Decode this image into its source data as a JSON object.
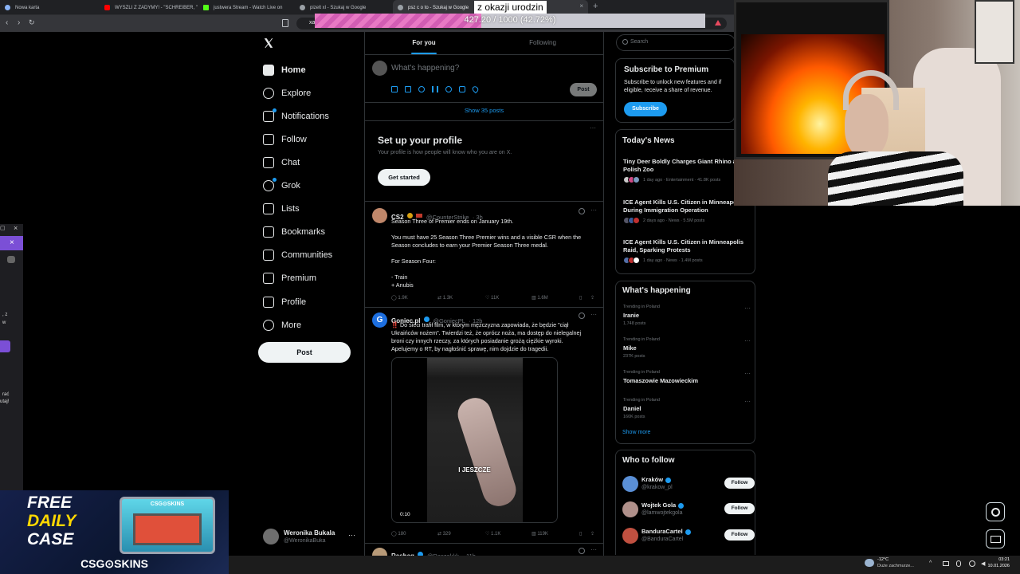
{
  "browser": {
    "tabs": [
      {
        "label": "Nowa karta",
        "color": "#8ab4f8"
      },
      {
        "label": "WYSZLI Z ZADYMY! - \"SCHREIBER, \"",
        "color": "#ff0000"
      },
      {
        "label": "justwera Stream - Watch Live on",
        "color": "#53fc18"
      },
      {
        "label": "pizelt xl - Szukaj w Google",
        "color": "#9aa0a6"
      },
      {
        "label": "psz c o to - Szukaj w Google",
        "color": "#9aa0a6"
      }
    ],
    "url_fragment": "xa"
  },
  "overlay": {
    "banner": "z okazji urodzin",
    "progress_text": "427.20 / 1000 (42.72%)",
    "progress_fraction": 0.4272
  },
  "sidebar": {
    "items": [
      {
        "label": "Home",
        "icon": "home-icon",
        "bold": true
      },
      {
        "label": "Explore",
        "icon": "search-icon"
      },
      {
        "label": "Notifications",
        "icon": "bell-icon"
      },
      {
        "label": "Follow",
        "icon": "add-user-icon"
      },
      {
        "label": "Chat",
        "icon": "mail-icon"
      },
      {
        "label": "Grok",
        "icon": "grok-icon"
      },
      {
        "label": "Lists",
        "icon": "list-icon"
      },
      {
        "label": "Bookmarks",
        "icon": "bookmark-icon"
      },
      {
        "label": "Communities",
        "icon": "people-icon"
      },
      {
        "label": "Premium",
        "icon": "x-logo-icon"
      },
      {
        "label": "Profile",
        "icon": "profile-icon"
      },
      {
        "label": "More",
        "icon": "more-circle-icon"
      }
    ],
    "post_label": "Post",
    "account": {
      "name": "Weronika Bukala",
      "handle": "@WeronikaBuka"
    }
  },
  "main": {
    "tabs": [
      "For you",
      "Following"
    ],
    "composer_placeholder": "What's happening?",
    "composer_post": "Post",
    "show_posts": "Show 35 posts",
    "setup": {
      "title": "Set up your profile",
      "subtitle": "Your profile is how people will know who you are on X.",
      "button": "Get started"
    },
    "tweets": [
      {
        "name": "CS2",
        "handle": "@CounterStrike",
        "time": "· 3h",
        "lines": [
          "Season Three of Premier ends on January 19th.",
          "",
          "You must have 25 Season Three Premier wins and a visible CSR when the",
          "Season concludes to earn your Premier Season Three medal.",
          "",
          "For Season Four:",
          "",
          "- Train",
          "+ Anubis"
        ],
        "replies": "1.9K",
        "reposts": "1.3K",
        "likes": "11K",
        "views": "1.6M"
      },
      {
        "name": "Goniec.pl",
        "handle": "@GoniecPL",
        "time": "· 12h",
        "lines": [
          "‼️ Do sieci trafił film, w którym mężczyzna zapowiada, że będzie \"ciął",
          "Ukraińców nożem\". Twierdzi też, że oprócz noża, ma dostęp do nielegalnej",
          "broni czy innych rzeczy, za których posiadanie grożą ciężkie wyroki.",
          "Apelujemy o RT, by nagłośnić sprawę, nim dojdzie do tragedii."
        ],
        "video_caption": "I JESZCZE",
        "video_time": "0:10",
        "replies": "180",
        "reposts": "329",
        "likes": "1.1K",
        "views": "119K"
      },
      {
        "name": "Rashaq",
        "handle": "@Raszakkk",
        "time": "· 11h"
      }
    ]
  },
  "right": {
    "search_placeholder": "Search",
    "premium": {
      "title": "Subscribe to Premium",
      "text_lines": [
        "Subscribe to unlock new features and if",
        "eligible, receive a share of revenue."
      ],
      "button": "Subscribe"
    },
    "news": {
      "title": "Today's News",
      "items": [
        {
          "headline_lines": [
            "Tiny Deer Boldly Charges Giant Rhino at",
            "Polish Zoo"
          ],
          "meta": "1 day ago · Entertainment · 41.8K posts"
        },
        {
          "headline_lines": [
            "ICE Agent Kills U.S. Citizen in Minneapolis",
            "During Immigration Operation"
          ],
          "meta": "2 days ago · News · 5.5M posts"
        },
        {
          "headline_lines": [
            "ICE Agent Kills U.S. Citizen in Minneapolis",
            "Raid, Sparking Protests"
          ],
          "meta": "1 day ago · News · 1.4M posts"
        }
      ]
    },
    "happening": {
      "title": "What's happening",
      "items": [
        {
          "meta": "Trending in Poland",
          "name": "Iranie",
          "count": "1,748 posts"
        },
        {
          "meta": "Trending in Poland",
          "name": "Mike",
          "count": "237K posts"
        },
        {
          "meta": "Trending in Poland",
          "name": "Tomaszowie Mazowieckim",
          "count": ""
        },
        {
          "meta": "Trending in Poland",
          "name": "Daniel",
          "count": "160K posts"
        }
      ],
      "show_more": "Show more"
    },
    "who_to_follow": {
      "title": "Who to follow",
      "items": [
        {
          "name": "Kraków",
          "handle": "@krakow_pl",
          "button": "Follow"
        },
        {
          "name": "Wojtek Gola",
          "handle": "@lamwojtekgola",
          "button": "Follow"
        },
        {
          "name": "BanduraCartel",
          "handle": "@BanduraCartel",
          "button": "Follow"
        }
      ]
    }
  },
  "ad": {
    "line1": "FREE",
    "line2": "DAILY",
    "line3": "CASE",
    "brand": "CSG⊙SKINS",
    "chest_label": "CSG⊙SKINS"
  },
  "left_panel": {
    "text1": ", z",
    "text2": "w",
    "text3": "rać",
    "text4": "utaj!"
  },
  "taskbar": {
    "weather_temp": "-12°C",
    "weather_desc": "Duże zachmurze...",
    "time": "03:21",
    "date": "10.01.2026"
  },
  "colors": {
    "accent": "#1d9bf0",
    "verified": "#1d9bf0",
    "progress": "#e879c4"
  }
}
